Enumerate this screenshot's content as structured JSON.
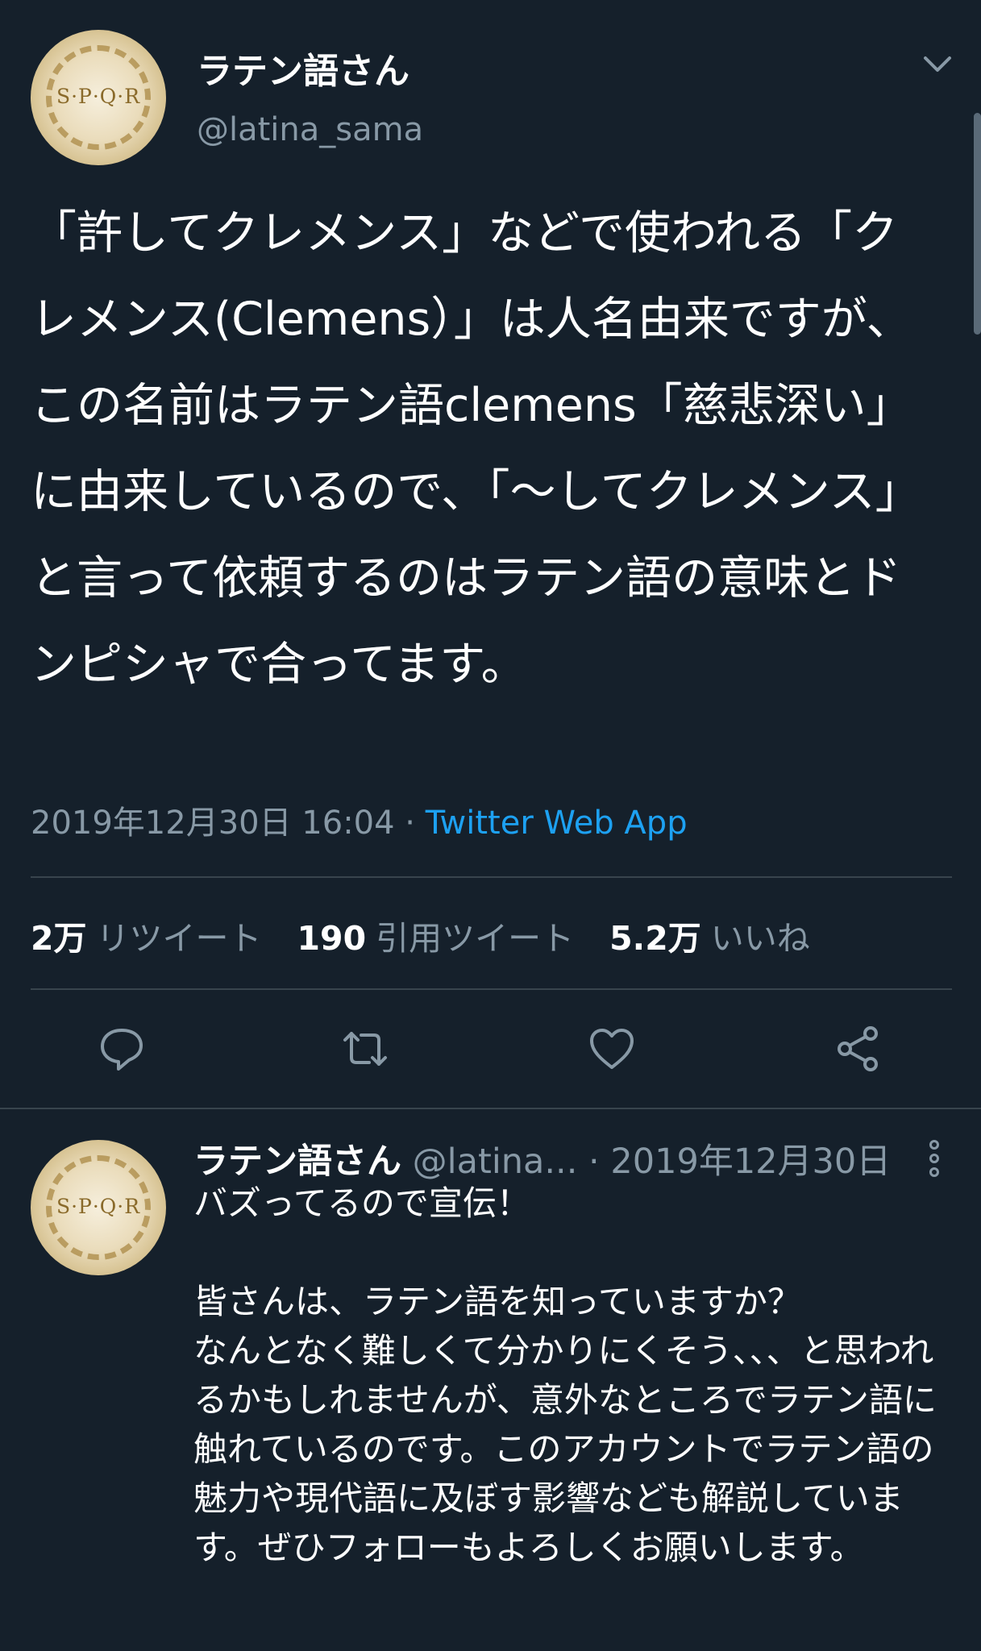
{
  "main_tweet": {
    "display_name": "ラテン語さん",
    "handle": "@latina_sama",
    "avatar_text": "S·P·Q·R",
    "body": "「許してクレメンス」などで使われる「クレメンス(Clemens）」は人名由来ですが、この名前はラテン語clemens「慈悲深い」に由来しているので、「〜してクレメンス」と言って依頼するのはラテン語の意味とドンピシャで合ってます。",
    "timestamp": "2019年12月30日 16:04 · ",
    "source_app": "Twitter Web App"
  },
  "stats": {
    "retweets_count": "2万",
    "retweets_label": "リツイート",
    "quotes_count": "190",
    "quotes_label": "引用ツイート",
    "likes_count": "5.2万",
    "likes_label": "いいね"
  },
  "actions": {
    "reply_icon": "reply-icon",
    "retweet_icon": "retweet-icon",
    "like_icon": "heart-icon",
    "share_icon": "share-icon"
  },
  "reply_tweet": {
    "display_name": "ラテン語さん",
    "handle": "@latina...",
    "date": " · 2019年12月30日",
    "avatar_text": "S·P·Q·R",
    "body": "バズってるので宣伝！\n\n皆さんは、ラテン語を知っていますか？\nなんとなく難しくて分かりにくそう、、、と思われるかもしれませんが、意外なところでラテン語に触れているのです。このアカウントでラテン語の魅力や現代語に及ぼす影響なども解説しています。ぜひフォローもよろしくお願いします。"
  },
  "colors": {
    "background": "#15202b",
    "text": "#ffffff",
    "secondary": "#8899a6",
    "accent": "#1da1f2",
    "divider": "#38444d"
  }
}
